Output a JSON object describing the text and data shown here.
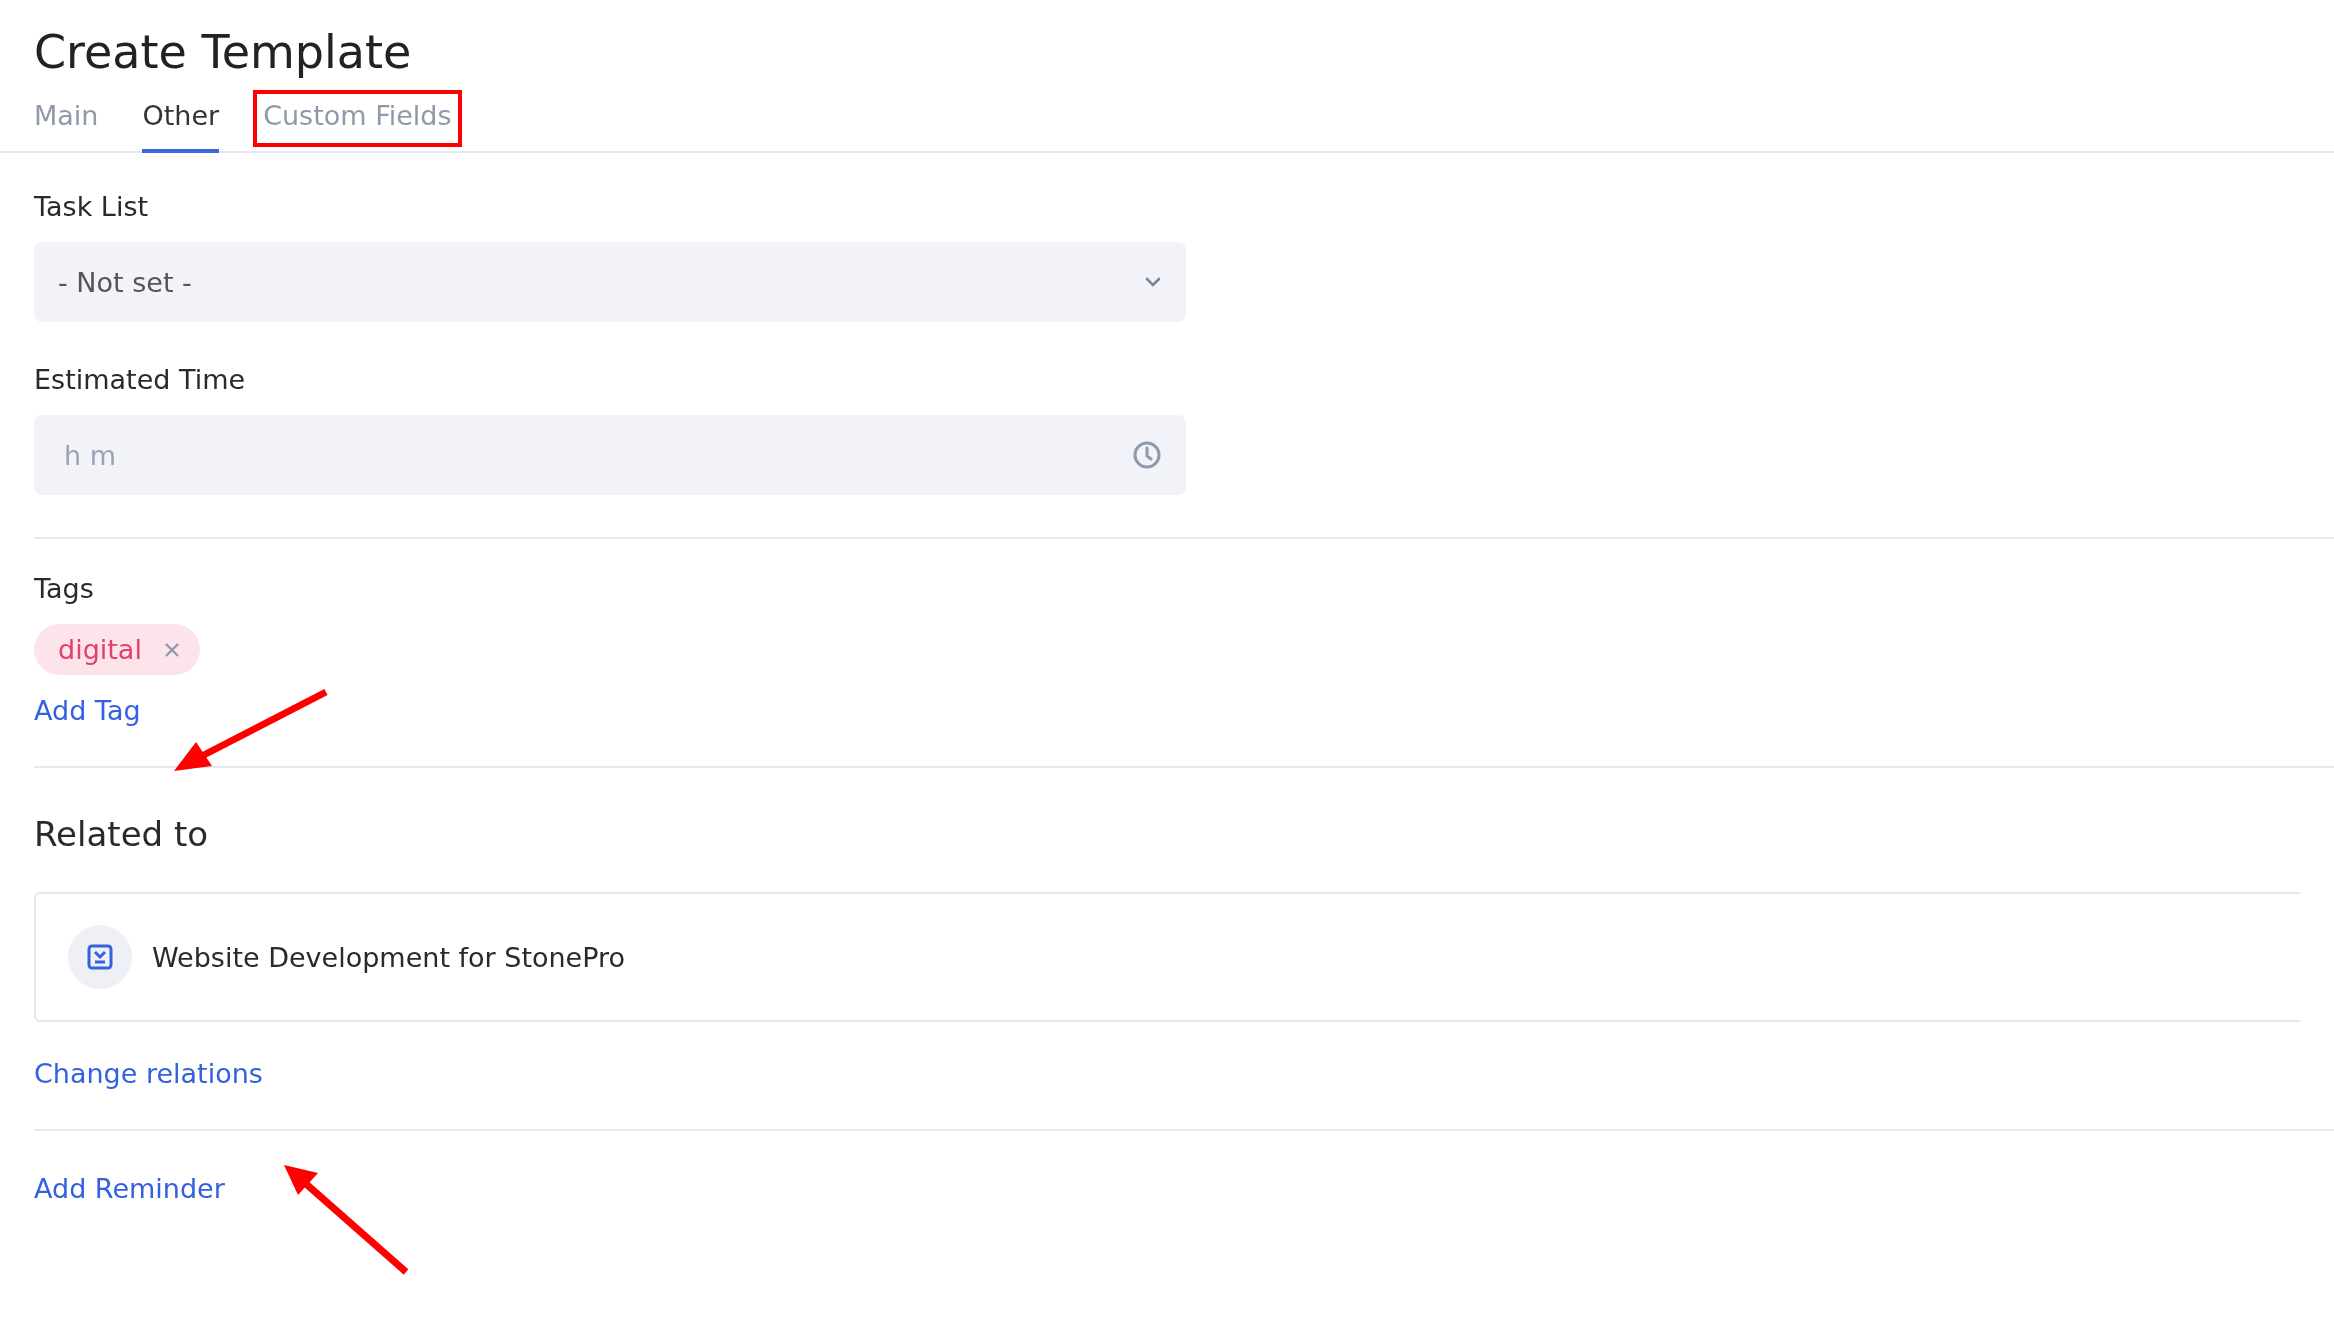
{
  "title": "Create Template",
  "tabs": [
    {
      "label": "Main",
      "selected": false
    },
    {
      "label": "Other",
      "selected": true
    },
    {
      "label": "Custom Fields",
      "selected": false,
      "highlighted": true
    }
  ],
  "task_list": {
    "label": "Task List",
    "value": "- Not set -"
  },
  "estimated_time": {
    "label": "Estimated Time",
    "placeholder": "h m"
  },
  "tags": {
    "label": "Tags",
    "items": [
      {
        "label": "digital"
      }
    ],
    "add_link": "Add Tag"
  },
  "related": {
    "heading": "Related to",
    "items": [
      {
        "name": "Website Development for StonePro"
      }
    ],
    "change_link": "Change relations"
  },
  "reminder_link": "Add Reminder"
}
